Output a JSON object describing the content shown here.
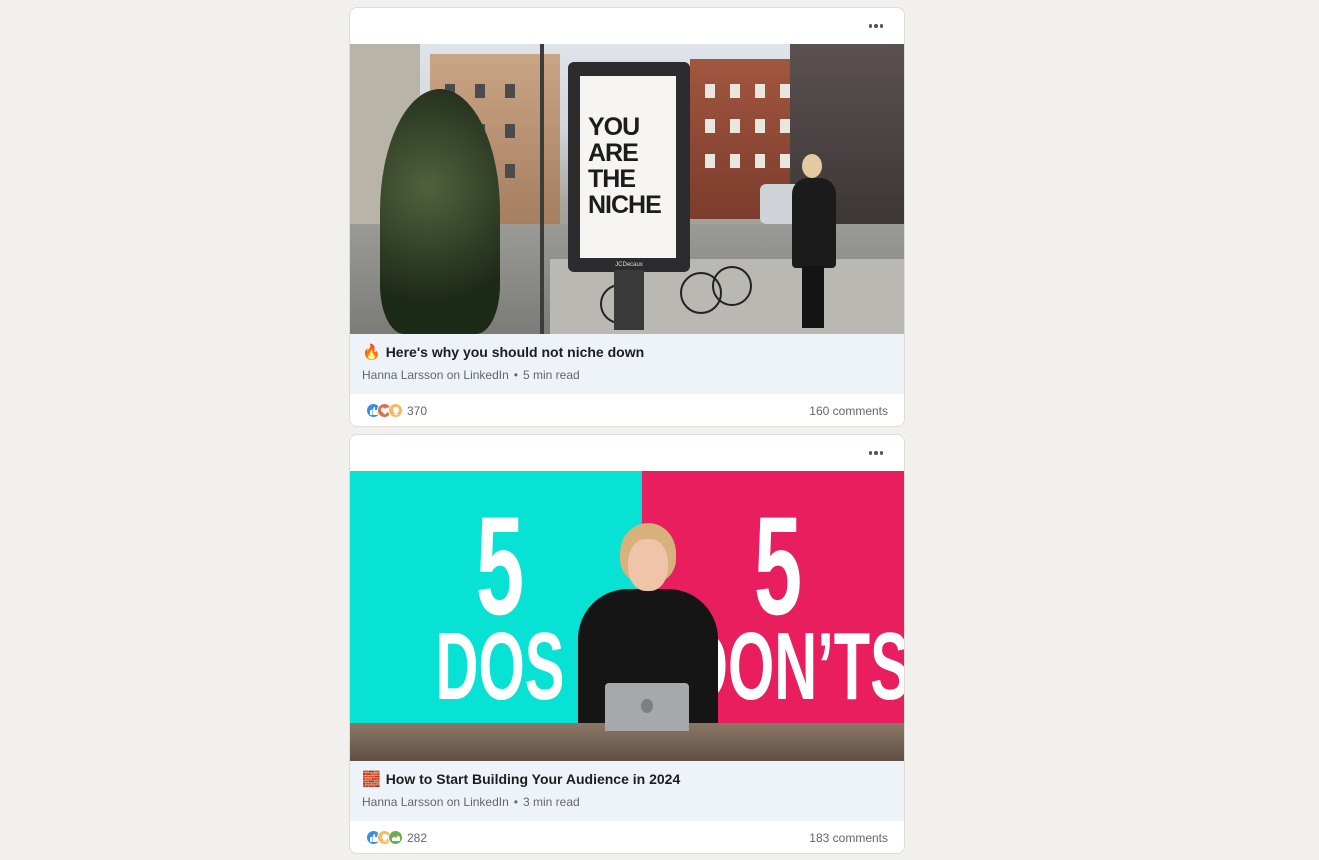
{
  "feed": {
    "posts": [
      {
        "image_text": [
          "YOU",
          "ARE",
          "THE",
          "NICHE"
        ],
        "billboard_brand": "JCDecaux",
        "emoji": "🔥",
        "title": "Here's why you should not niche down",
        "author_line": "Hanna Larsson on LinkedIn",
        "read_time": "5 min read",
        "reactions": [
          "like-icon",
          "love-icon",
          "insightful-icon"
        ],
        "reaction_count": "370",
        "comments": "160 comments"
      },
      {
        "image_text": {
          "left_number": "5",
          "left_word": "DOS",
          "right_number": "5",
          "right_word": "DON’TS"
        },
        "emoji": "🧱",
        "title": "How to Start Building Your Audience in 2024",
        "author_line": "Hanna Larsson on LinkedIn",
        "read_time": "3 min read",
        "reactions": [
          "like-icon",
          "insightful-icon",
          "support-icon"
        ],
        "reaction_count": "282",
        "comments": "183 comments"
      }
    ],
    "separator": "•"
  },
  "colors": {
    "page_bg": "#f1f0ec",
    "article_bg": "#edf3f8",
    "like": "#378fe9",
    "love": "#df704d",
    "insightful": "#f5bb5c",
    "support": "#6dae4f",
    "cyan": "#08e2d4",
    "pink": "#e81e5e"
  }
}
